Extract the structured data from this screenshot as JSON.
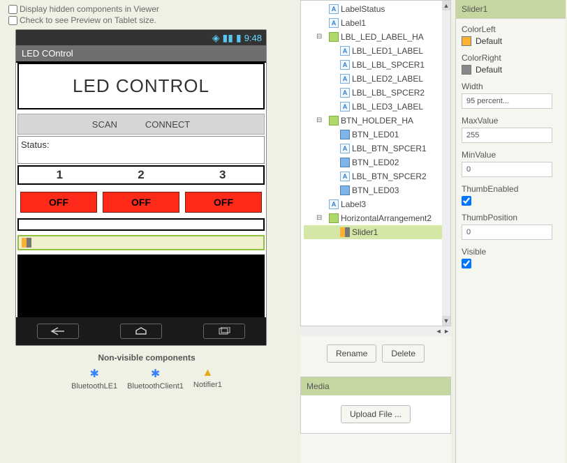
{
  "viewer": {
    "checkbox_hidden": "Display hidden components in Viewer",
    "checkbox_tablet": "Check to see Preview on Tablet size.",
    "status_time": "9:48",
    "app_title": "LED COntrol",
    "heading": "LED CONTROL",
    "btn_scan": "SCAN",
    "btn_connect": "CONNECT",
    "status_label": "Status:",
    "lbl1": "1",
    "lbl2": "2",
    "lbl3": "3",
    "off1": "OFF",
    "off2": "OFF",
    "off3": "OFF",
    "nonvisible_header": "Non-visible components",
    "nonvis": [
      "BluetoothLE1",
      "BluetoothClient1",
      "Notifier1"
    ]
  },
  "tree": {
    "items": [
      {
        "depth": 2,
        "icon": "label",
        "label": "LabelStatus"
      },
      {
        "depth": 2,
        "icon": "label",
        "label": "Label1"
      },
      {
        "depth": 2,
        "icon": "ha",
        "label": "LBL_LED_LABEL_HA",
        "toggle": "-"
      },
      {
        "depth": 3,
        "icon": "label",
        "label": "LBL_LED1_LABEL"
      },
      {
        "depth": 3,
        "icon": "label",
        "label": "LBL_LBL_SPCER1"
      },
      {
        "depth": 3,
        "icon": "label",
        "label": "LBL_LED2_LABEL"
      },
      {
        "depth": 3,
        "icon": "label",
        "label": "LBL_LBL_SPCER2"
      },
      {
        "depth": 3,
        "icon": "label",
        "label": "LBL_LED3_LABEL"
      },
      {
        "depth": 2,
        "icon": "ha",
        "label": "BTN_HOLDER_HA",
        "toggle": "-"
      },
      {
        "depth": 3,
        "icon": "btn",
        "label": "BTN_LED01"
      },
      {
        "depth": 3,
        "icon": "label",
        "label": "LBL_BTN_SPCER1"
      },
      {
        "depth": 3,
        "icon": "btn",
        "label": "BTN_LED02"
      },
      {
        "depth": 3,
        "icon": "label",
        "label": "LBL_BTN_SPCER2"
      },
      {
        "depth": 3,
        "icon": "btn",
        "label": "BTN_LED03"
      },
      {
        "depth": 2,
        "icon": "label",
        "label": "Label3"
      },
      {
        "depth": 2,
        "icon": "ha",
        "label": "HorizontalArrangement2",
        "toggle": "-"
      },
      {
        "depth": 3,
        "icon": "slider",
        "label": "Slider1",
        "selected": true
      }
    ],
    "btn_rename": "Rename",
    "btn_delete": "Delete"
  },
  "media": {
    "header": "Media",
    "upload": "Upload File ..."
  },
  "props": {
    "header": "Slider1",
    "color_left_lbl": "ColorLeft",
    "color_left_val": "Default",
    "color_right_lbl": "ColorRight",
    "color_right_val": "Default",
    "width_lbl": "Width",
    "width_val": "95 percent...",
    "max_lbl": "MaxValue",
    "max_val": "255",
    "min_lbl": "MinValue",
    "min_val": "0",
    "thumb_en_lbl": "ThumbEnabled",
    "thumb_en_val": true,
    "thumb_pos_lbl": "ThumbPosition",
    "thumb_pos_val": "0",
    "visible_lbl": "Visible",
    "visible_val": true
  }
}
